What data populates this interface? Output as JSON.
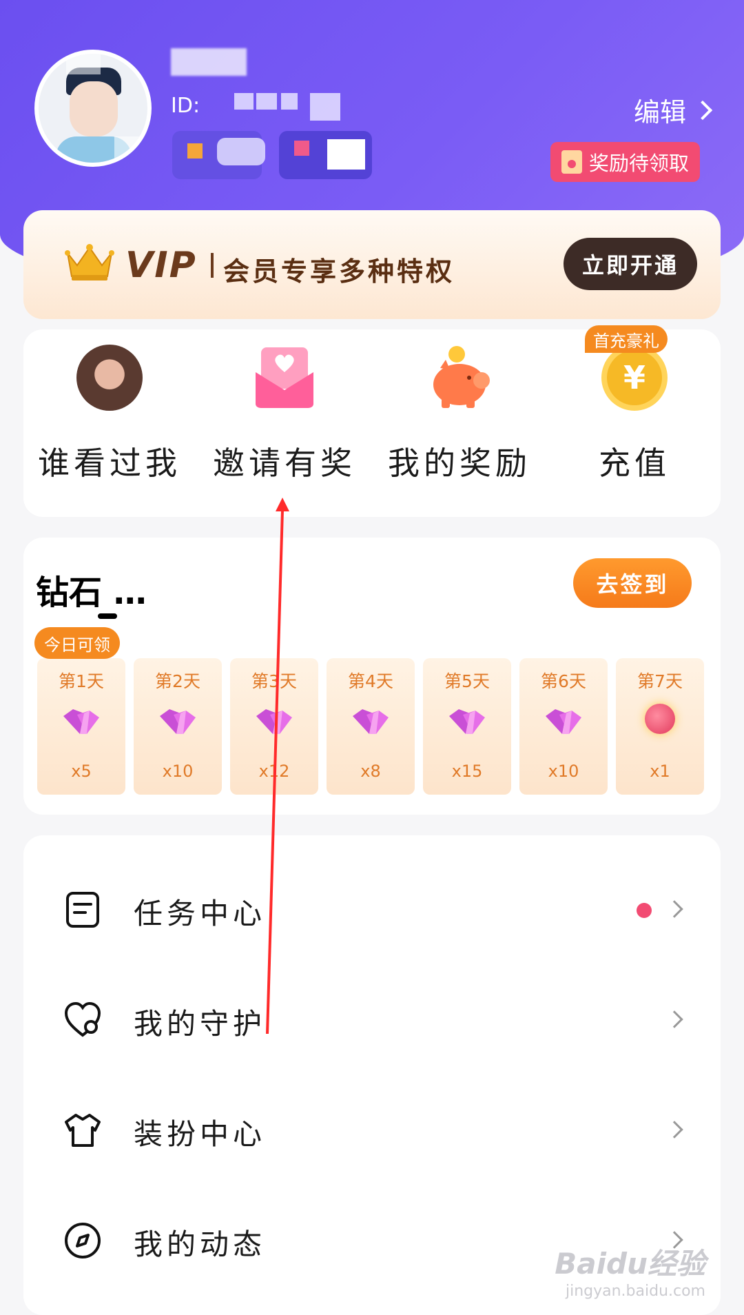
{
  "header": {
    "nickname": "",
    "id_label": "ID:",
    "edit_label": "编辑",
    "reward_pending_label": "奖励待领取"
  },
  "vip": {
    "logo": "VIP",
    "tagline": "会员专享多种特权",
    "activate_label": "立即开通"
  },
  "quick_actions": [
    {
      "label": "谁看过我",
      "icon": "viewer-avatar-icon"
    },
    {
      "label": "邀请有奖",
      "icon": "invite-envelope-icon"
    },
    {
      "label": "我的奖励",
      "icon": "piggy-bank-icon"
    },
    {
      "label": "充值",
      "icon": "yuan-coin-icon",
      "tag": "首充豪礼"
    }
  ],
  "checkin": {
    "title": "钻石 …",
    "button_label": "去签到",
    "today_tag": "今日可领",
    "days": [
      {
        "label": "第1天",
        "amount": "x5",
        "reward": "diamond"
      },
      {
        "label": "第2天",
        "amount": "x10",
        "reward": "diamond"
      },
      {
        "label": "第3天",
        "amount": "x12",
        "reward": "diamond"
      },
      {
        "label": "第4天",
        "amount": "x8",
        "reward": "diamond"
      },
      {
        "label": "第5天",
        "amount": "x15",
        "reward": "diamond"
      },
      {
        "label": "第6天",
        "amount": "x10",
        "reward": "diamond"
      },
      {
        "label": "第7天",
        "amount": "x1",
        "reward": "gift-bomb"
      }
    ]
  },
  "menu": [
    {
      "label": "任务中心",
      "icon": "task-list-icon",
      "has_dot": true
    },
    {
      "label": "我的守护",
      "icon": "heart-guard-icon",
      "has_dot": false
    },
    {
      "label": "装扮中心",
      "icon": "tshirt-icon",
      "has_dot": false
    },
    {
      "label": "我的动态",
      "icon": "compass-icon",
      "has_dot": false
    }
  ],
  "watermark": {
    "brand": "Baidu经验",
    "url": "jingyan.baidu.com"
  },
  "colors": {
    "header_purple": "#6b4ff0",
    "accent_orange": "#f58a1f",
    "reward_pink": "#f24b72",
    "vip_brown": "#3d2b26",
    "annotation_red": "#ff2a2a"
  }
}
